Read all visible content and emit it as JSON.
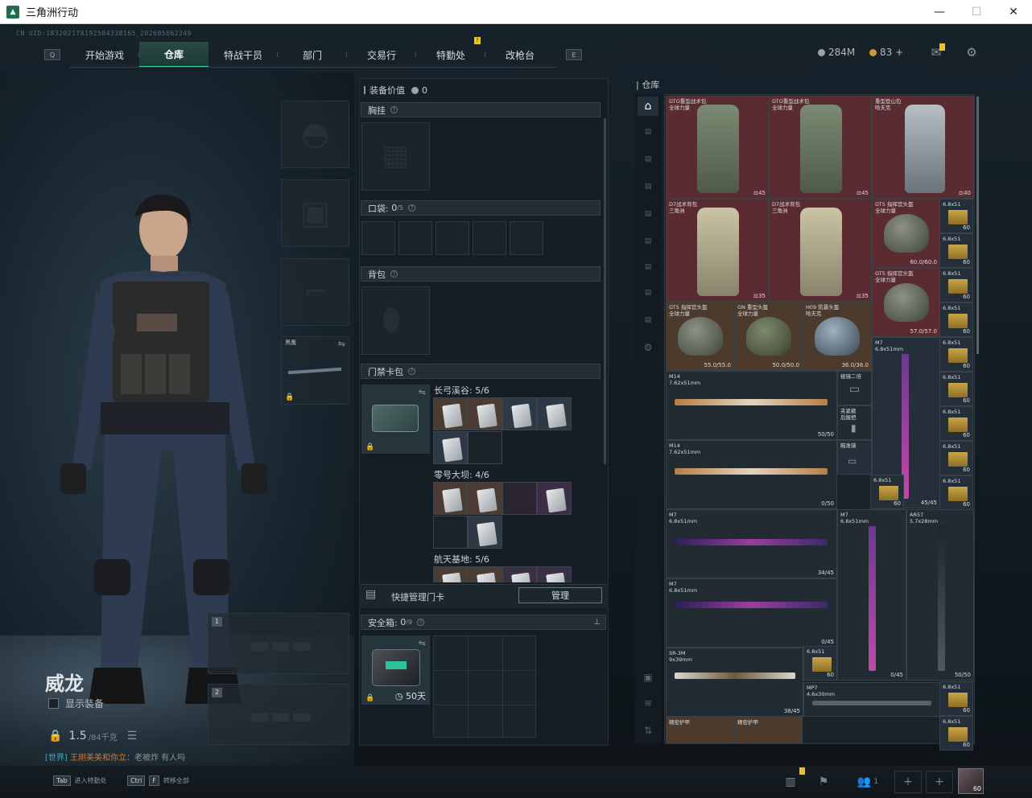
{
  "window": {
    "title": "三角洲行动",
    "min": "—",
    "max": "☐",
    "close": "✕"
  },
  "uid": "CN UID:1832021781925043381​65_202605062249",
  "nav": {
    "tabs": [
      "开始游戏",
      "仓库",
      "特战干员",
      "部门",
      "交易行",
      "特勤处",
      "改枪台"
    ],
    "active": "仓库",
    "left_key": "Q",
    "right_key": "E",
    "badge": "!"
  },
  "currency": {
    "coins": "284M",
    "tickets": "83",
    "plus": "+"
  },
  "character": {
    "name": "威龙",
    "show_equipment_label": "显示装备",
    "weight": "1.5",
    "weight_max": "/84千克",
    "melee_label": "黑鹰",
    "weapon_slot_1": "1",
    "weapon_slot_2": "2"
  },
  "chat": {
    "channel": "[世界]",
    "user": "王刚美美和你立",
    "msg": "：老被炸 有人吗"
  },
  "equipment": {
    "value_label": "装备价值",
    "value": "0",
    "chest_rig": "胸挂",
    "pocket": "口袋:",
    "pocket_count": "0",
    "pocket_max": "/5",
    "backpack": "背包",
    "keycard": "门禁卡包",
    "maps": [
      {
        "name": "长弓溪谷:",
        "count": "5/6"
      },
      {
        "name": "零号大坝:",
        "count": "4/6"
      },
      {
        "name": "航天基地:",
        "count": "5/6"
      }
    ],
    "quick_manage": "快捷管理门卡",
    "manage_btn": "管理",
    "safebox": "安全箱:",
    "safebox_count": "0",
    "safebox_max": "/9",
    "safebox_days": "50天"
  },
  "warehouse": {
    "title": "仓库",
    "items": [
      {
        "name": "GTO重型战术包",
        "sub": "全球力量",
        "count": "45"
      },
      {
        "name": "GTO重型战术包",
        "sub": "全球力量",
        "count": "45"
      },
      {
        "name": "重型登山包",
        "sub": "哈夫克",
        "count": "40"
      },
      {
        "name": "D7战术背包",
        "sub": "三角洲",
        "count": "35"
      },
      {
        "name": "D7战术背包",
        "sub": "三角洲",
        "count": "35"
      },
      {
        "name": "GT5 指挥官头盔",
        "sub": "全球力量",
        "count": "60.0/60.0"
      },
      {
        "name": "GT5 指挥官头盔",
        "sub": "全球力量",
        "count": "57.0/57.0"
      },
      {
        "name": "GT5 指挥官头盔",
        "sub": "全球力量",
        "count": "55.0/55.0"
      },
      {
        "name": "GN 重型头盔",
        "sub": "全球力量",
        "count": "50.0/50.0"
      },
      {
        "name": "H09 防暴头盔",
        "sub": "哈夫克",
        "count": "36.0/36.0"
      },
      {
        "name": "M14",
        "sub": "7.62x51mm",
        "count": "50/50"
      },
      {
        "name": "M14",
        "sub": "7.62x51mm",
        "count": "0/50"
      },
      {
        "name": "M7",
        "sub": "6.8x51mm",
        "count": "45/45"
      },
      {
        "name": "M7",
        "sub": "6.8x51mm",
        "count": "34/45"
      },
      {
        "name": "M7",
        "sub": "6.8x51mm",
        "count": "0/45"
      },
      {
        "name": "M7",
        "sub": "6.8x51mm",
        "count": "0/45"
      },
      {
        "name": "AR57",
        "sub": "5.7x28mm",
        "count": "50/50"
      },
      {
        "name": "SR-3M",
        "sub": "9x39mm",
        "count": "38/45"
      },
      {
        "name": "MP7",
        "sub": "4.6x30mm",
        "count": ""
      },
      {
        "name": "棱镜二倍",
        "sub": "",
        "count": ""
      },
      {
        "name": "夹紧箍",
        "sub": "后握把",
        "count": ""
      },
      {
        "name": "瞄准镜",
        "sub": "",
        "count": ""
      },
      {
        "name": "精密护甲",
        "sub": "",
        "count": ""
      },
      {
        "name": "精密护甲",
        "sub": "",
        "count": ""
      }
    ],
    "ammo_label": "6.8x51",
    "ammo_count": "60"
  },
  "bottom": {
    "tab_key": "Tab",
    "tab_action": "进入特勤处",
    "ctrl_key": "Ctrl",
    "f_key": "F",
    "ctrl_action": "转移全部",
    "squad": "1",
    "avatar_level": "60"
  }
}
